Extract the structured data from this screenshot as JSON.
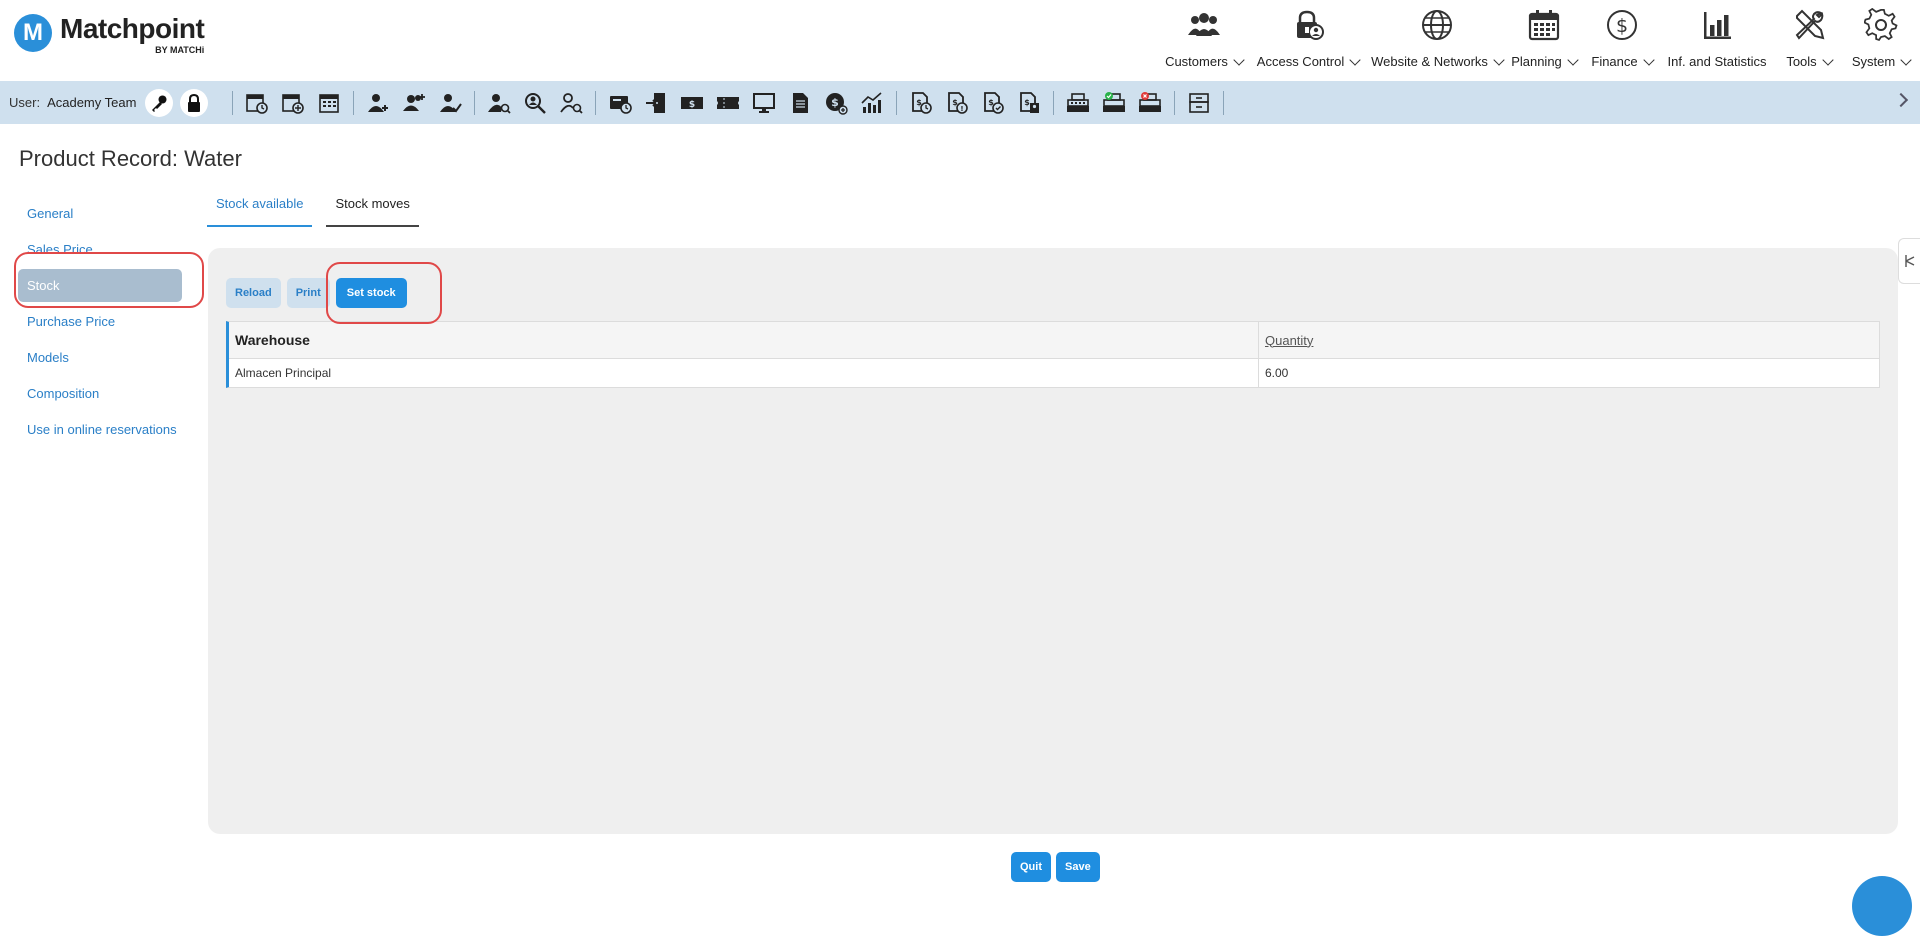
{
  "brand": {
    "logo_letter": "M",
    "name": "Matchpoint",
    "sub": "BY MATCHi",
    "color": "#2a8fd9"
  },
  "topnav": [
    {
      "label": "Customers",
      "icon": "people-icon",
      "chevron": true
    },
    {
      "label": "Access Control",
      "icon": "lock-user-icon",
      "chevron": true
    },
    {
      "label": "Website & Networks",
      "icon": "globe-icon",
      "chevron": true
    },
    {
      "label": "Planning",
      "icon": "calendar-icon",
      "chevron": true
    },
    {
      "label": "Finance",
      "icon": "dollar-icon",
      "chevron": true
    },
    {
      "label": "Inf. and Statistics",
      "icon": "bar-chart-icon",
      "chevron": false
    },
    {
      "label": "Tools",
      "icon": "tools-icon",
      "chevron": true
    },
    {
      "label": "System",
      "icon": "gear-icon",
      "chevron": true
    }
  ],
  "toolbar": {
    "user_label": "User:",
    "user_name": "Academy Team"
  },
  "page": {
    "title": "Product Record: Water"
  },
  "leftnav": [
    {
      "label": "General",
      "active": false
    },
    {
      "label": "Sales Price",
      "active": false
    },
    {
      "label": "Stock",
      "active": true
    },
    {
      "label": "Purchase Price",
      "active": false
    },
    {
      "label": "Models",
      "active": false
    },
    {
      "label": "Composition",
      "active": false
    },
    {
      "label": "Use in online reservations",
      "active": false
    }
  ],
  "tabs": [
    {
      "label": "Stock available",
      "active": true
    },
    {
      "label": "Stock moves",
      "active": false
    }
  ],
  "panel_buttons": {
    "reload": "Reload",
    "print": "Print",
    "set_stock": "Set stock"
  },
  "grid": {
    "columns": [
      "Warehouse",
      "Quantity"
    ],
    "rows": [
      [
        "Almacen Principal",
        "6.00"
      ]
    ]
  },
  "bottom": {
    "quit": "Quit",
    "save": "Save"
  },
  "colors": {
    "accent": "#1f8ee0",
    "toolbar_bg": "#cfe0ee",
    "highlight": "#e04848"
  }
}
